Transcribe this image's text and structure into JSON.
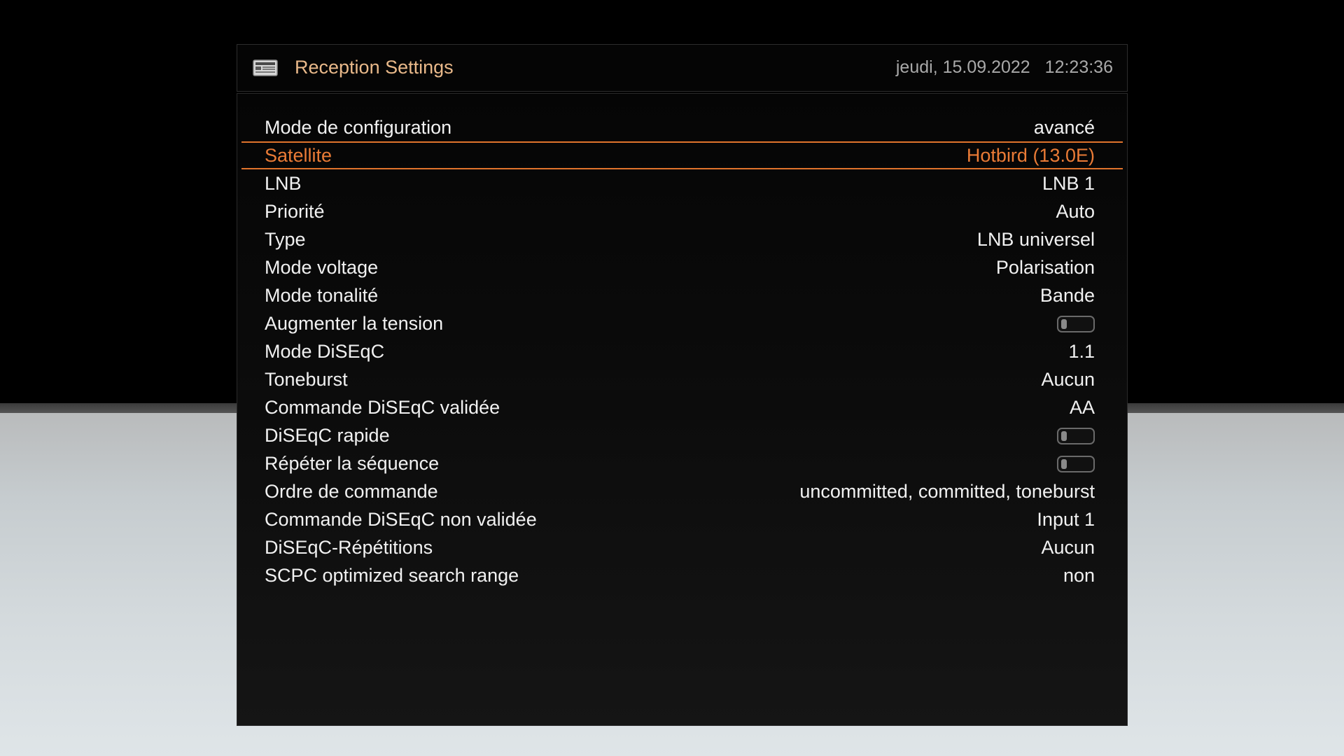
{
  "header": {
    "title": "Reception Settings",
    "icon": "settings-screen-icon",
    "date": "jeudi, 15.09.2022",
    "time": "12:23:36"
  },
  "colors": {
    "accent": "#ea7b36",
    "title": "#e9b98a",
    "text": "#f1f1f1",
    "datetime": "#a9a9a9"
  },
  "settings": [
    {
      "name": "mode-de-configuration",
      "label": "Mode de configuration",
      "value": "avancé",
      "kind": "text"
    },
    {
      "name": "satellite",
      "label": "Satellite",
      "value": "Hotbird (13.0E)",
      "kind": "text",
      "selected": true
    },
    {
      "name": "lnb",
      "label": "LNB",
      "value": "LNB 1",
      "kind": "text"
    },
    {
      "name": "priorite",
      "label": "Priorité",
      "value": "Auto",
      "kind": "text"
    },
    {
      "name": "type",
      "label": "Type",
      "value": "LNB universel",
      "kind": "text"
    },
    {
      "name": "mode-voltage",
      "label": "Mode voltage",
      "value": "Polarisation",
      "kind": "text"
    },
    {
      "name": "mode-tonalite",
      "label": "Mode tonalité",
      "value": "Bande",
      "kind": "text"
    },
    {
      "name": "augmenter-la-tension",
      "label": "Augmenter la tension",
      "value": false,
      "kind": "toggle"
    },
    {
      "name": "mode-diseqc",
      "label": "Mode DiSEqC",
      "value": "1.1",
      "kind": "text"
    },
    {
      "name": "toneburst",
      "label": "Toneburst",
      "value": "Aucun",
      "kind": "text"
    },
    {
      "name": "commande-diseqc-validee",
      "label": "Commande DiSEqC validée",
      "value": "AA",
      "kind": "text"
    },
    {
      "name": "diseqc-rapide",
      "label": "DiSEqC rapide",
      "value": false,
      "kind": "toggle"
    },
    {
      "name": "repeter-la-sequence",
      "label": "Répéter la séquence",
      "value": false,
      "kind": "toggle"
    },
    {
      "name": "ordre-de-commande",
      "label": "Ordre de commande",
      "value": "uncommitted, committed, toneburst",
      "kind": "text"
    },
    {
      "name": "commande-diseqc-non-validee",
      "label": "Commande DiSEqC non validée",
      "value": "Input 1",
      "kind": "text"
    },
    {
      "name": "diseqc-repetitions",
      "label": "DiSEqC-Répétitions",
      "value": "Aucun",
      "kind": "text"
    },
    {
      "name": "scpc-optimized-search-range",
      "label": "SCPC optimized search range",
      "value": "non",
      "kind": "text"
    }
  ]
}
